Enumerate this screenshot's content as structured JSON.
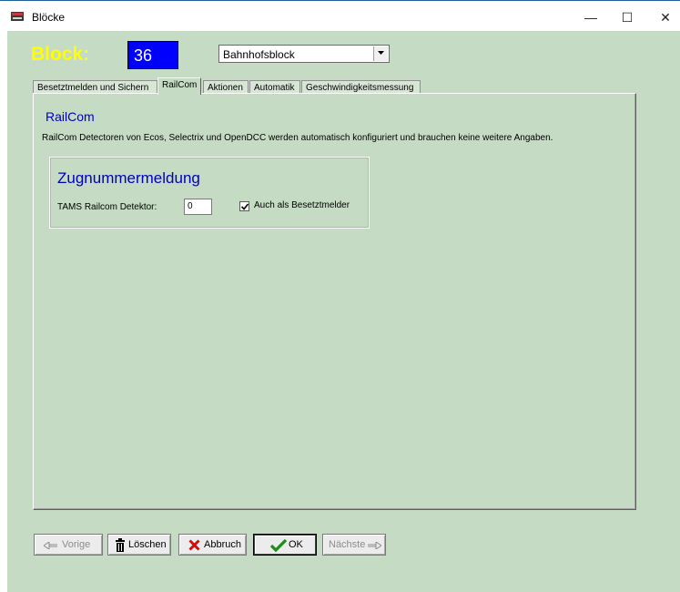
{
  "window": {
    "title": "Blöcke",
    "min_glyph": "—",
    "max_glyph": "☐",
    "close_glyph": "✕"
  },
  "header": {
    "block_label": "Block:",
    "block_number": "36",
    "block_type_selected": "Bahnhofsblock"
  },
  "tabs": [
    {
      "label": "Besetztmelden und Sichern",
      "active": false
    },
    {
      "label": "RailCom",
      "active": true
    },
    {
      "label": "Aktionen",
      "active": false
    },
    {
      "label": "Automatik",
      "active": false
    },
    {
      "label": "Geschwindigkeitsmessung",
      "active": false
    }
  ],
  "railcom": {
    "title": "RailCom",
    "description": "RailCom Detectoren von Ecos, Selectrix und OpenDCC werden automatisch konfiguriert und brauchen keine weitere Angaben.",
    "group_title": "Zugnummermeldung",
    "tams_label": "TAMS Railcom Detektor:",
    "tams_value": "0",
    "occupancy_label": "Auch als Besetztmelder",
    "occupancy_checked": true
  },
  "buttons": {
    "prev": "Vorige",
    "delete": "Löschen",
    "cancel": "Abbruch",
    "ok": "OK",
    "next": "Nächste"
  },
  "colors": {
    "background": "#c5dbc3",
    "block_label": "#ffff00",
    "block_number_bg": "#0000ff",
    "heading_blue": "#0000c0"
  }
}
